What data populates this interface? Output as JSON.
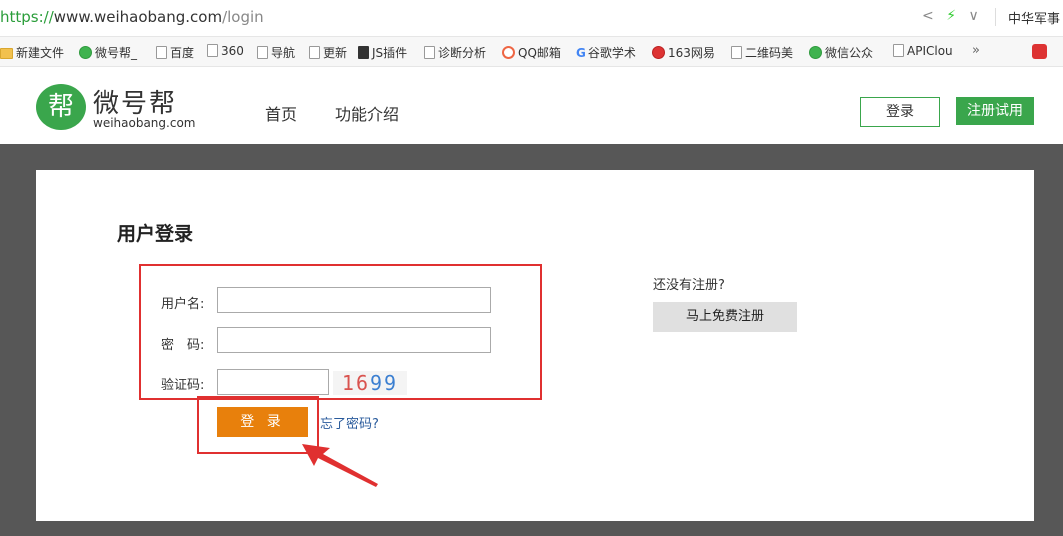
{
  "browser": {
    "url_protocol": "https://",
    "url_domain": "www.weihaobang.com",
    "url_path": "/login",
    "right_link": "中华军事"
  },
  "bookmarks": [
    {
      "label": "新建文件",
      "icon": "folder-icon"
    },
    {
      "label": "微号帮_",
      "icon": "wechat-icon"
    },
    {
      "label": "百度",
      "icon": "page-icon"
    },
    {
      "label": "360",
      "icon": "page-icon"
    },
    {
      "label": "导航",
      "icon": "page-icon"
    },
    {
      "label": "更新",
      "icon": "page-icon"
    },
    {
      "label": "JS插件",
      "icon": "js-icon"
    },
    {
      "label": "诊断分析",
      "icon": "page-icon"
    },
    {
      "label": "QQ邮箱",
      "icon": "qq-icon"
    },
    {
      "label": "谷歌学术",
      "icon": "google-icon"
    },
    {
      "label": "163网易",
      "icon": "netease-icon"
    },
    {
      "label": "二维码美",
      "icon": "page-icon"
    },
    {
      "label": "微信公众",
      "icon": "wechat-icon"
    },
    {
      "label": "APIClou",
      "icon": "page-icon"
    }
  ],
  "bookmarks_more": "»",
  "site": {
    "logo_char": "帮",
    "logo_name": "微号帮",
    "logo_domain": "weihaobang.com",
    "nav": [
      "首页",
      "功能介绍"
    ],
    "login_button": "登录",
    "register_button": "注册试用"
  },
  "login": {
    "title": "用户登录",
    "username_label": "用户名:",
    "password_label": "密　码:",
    "captcha_label": "验证码:",
    "username_value": "",
    "password_value": "",
    "captcha_value": "",
    "captcha_digits": [
      "1",
      "6",
      "9",
      "9"
    ],
    "submit_label": "登 录",
    "forgot_link": "忘了密码?"
  },
  "signup": {
    "prompt": "还没有注册?",
    "button": "马上免费注册"
  },
  "colors": {
    "brand_green": "#3aa64c",
    "submit_orange": "#e8800c",
    "annotation_red": "#e03030",
    "stage_gray": "#575757"
  }
}
